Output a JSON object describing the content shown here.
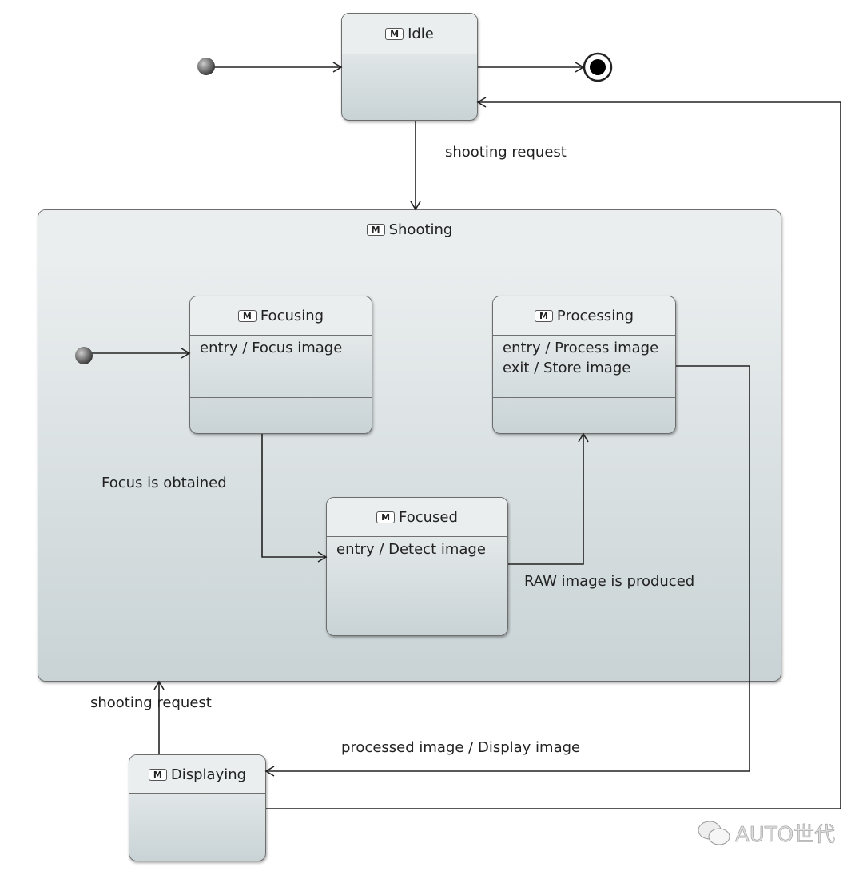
{
  "stereotype_badge": "M",
  "states": {
    "idle": {
      "name": "Idle"
    },
    "shooting": {
      "name": "Shooting"
    },
    "focusing": {
      "name": "Focusing",
      "actions": [
        "entry / Focus image"
      ]
    },
    "processing": {
      "name": "Processing",
      "actions": [
        "entry / Process image",
        "exit / Store image"
      ]
    },
    "focused": {
      "name": "Focused",
      "actions": [
        "entry / Detect image"
      ]
    },
    "displaying": {
      "name": "Displaying"
    }
  },
  "transitions": {
    "idle_to_shooting": "shooting request",
    "focusing_to_focused": "Focus is obtained",
    "focused_to_processing": "RAW image is produced",
    "processing_to_displaying": "processed image / Display image",
    "displaying_to_shooting": "shooting request"
  },
  "watermark": "AUTO世代"
}
